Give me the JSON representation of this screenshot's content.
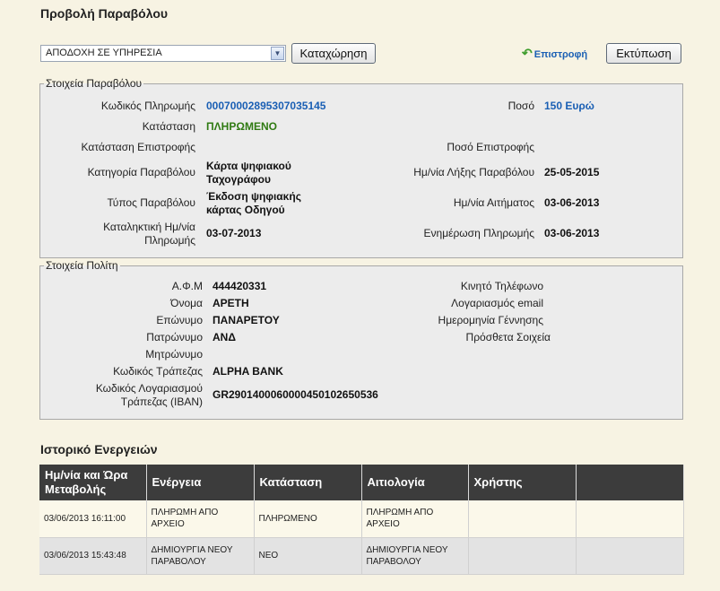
{
  "page_title": "Προβολή Παραβόλου",
  "toolbar": {
    "status_select": "ΑΠΟΔΟΧΗ ΣΕ ΥΠΗΡΕΣΙΑ",
    "submit_label": "Καταχώρηση",
    "back_label": "Επιστροφή",
    "print_label": "Εκτύπωση"
  },
  "fee": {
    "legend": "Στοιχεία Παραβόλου",
    "payment_code_label": "Κωδικός Πληρωμής",
    "payment_code": "00070002895307035145",
    "amount_label": "Ποσό",
    "amount": "150 Ευρώ",
    "status_label": "Κατάσταση",
    "status": "ΠΛΗΡΩΜΕΝΟ",
    "refund_status_label": "Κατάσταση Επιστροφής",
    "refund_amount_label": "Ποσό Επιστροφής",
    "category_label": "Κατηγορία Παραβόλου",
    "category_line1": "Κάρτα ψηφιακού",
    "category_line2": "Ταχογράφου",
    "expiry_label": "Ημ/νία Λήξης Παραβόλου",
    "expiry": "25-05-2015",
    "type_label": "Τύπος Παραβόλου",
    "type_line1": "Έκδοση ψηφιακής",
    "type_line2": "κάρτας Οδηγού",
    "request_date_label": "Ημ/νία Αιτήματος",
    "request_date": "03-06-2013",
    "deadline_label_line1": "Καταληκτική Ημ/νία",
    "deadline_label_line2": "Πληρωμής",
    "deadline": "03-07-2013",
    "payment_update_label": "Ενημέρωση Πληρωμής",
    "payment_update": "03-06-2013"
  },
  "citizen": {
    "legend": "Στοιχεία Πολίτη",
    "afm_label": "Α.Φ.Μ",
    "afm": "444420331",
    "first_name_label": "Όνομα",
    "first_name": "ΑΡΕΤΗ",
    "last_name_label": "Επώνυμο",
    "last_name": "ΠΑΝΑΡΕΤΟΥ",
    "father_label": "Πατρώνυμο",
    "father": "ΑΝΔ",
    "mother_label": "Μητρώνυμο",
    "bank_code_label": "Κωδικός Τράπεζας",
    "bank_code": "ALPHA BANK",
    "iban_label_line1": "Κωδικός Λογαριασμού",
    "iban_label_line2": "Τράπεζας (IBAN)",
    "iban": "GR2901400060000450102650536",
    "mobile_label": "Κινητό Τηλέφωνο",
    "email_label": "Λογαριασμός email",
    "birth_label": "Ημερομηνία Γέννησης",
    "extra_label": "Πρόσθετα Σοιχεία"
  },
  "history": {
    "title": "Ιστορικό Ενεργειών",
    "columns": [
      "Ημ/νία και Ώρα Μεταβολής",
      "Ενέργεια",
      "Κατάσταση",
      "Αιτιολογία",
      "Χρήστης",
      ""
    ],
    "rows": [
      [
        "03/06/2013 16:11:00",
        "ΠΛΗΡΩΜΗ ΑΠΟ ΑΡΧΕΙΟ",
        "ΠΛΗΡΩΜΕΝΟ",
        "ΠΛΗΡΩΜΗ ΑΠΟ ΑΡΧΕΙΟ",
        "",
        ""
      ],
      [
        "03/06/2013 15:43:48",
        "ΔΗΜΙΟΥΡΓΙΑ ΝΕΟΥ ΠΑΡΑΒΟΛΟΥ",
        "ΝΕΟ",
        "ΔΗΜΙΟΥΡΓΙΑ ΝΕΟΥ ΠΑΡΑΒΟΛΟΥ",
        "",
        ""
      ]
    ]
  }
}
